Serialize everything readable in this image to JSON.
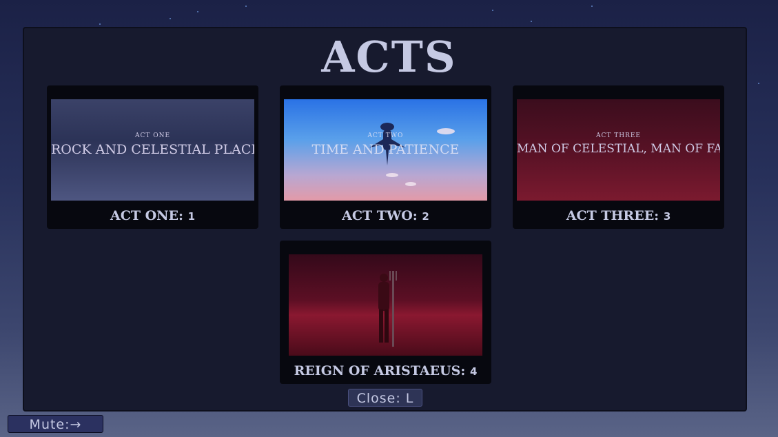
{
  "title": "ACTS",
  "cards": [
    {
      "label": "ACT ONE:",
      "number": "1",
      "thumb_small": "ACT ONE",
      "thumb_title": "ROCK AND CELESTIAL PLACE"
    },
    {
      "label": "ACT TWO:",
      "number": "2",
      "thumb_small": "ACT TWO",
      "thumb_title": "TIME AND PATIENCE"
    },
    {
      "label": "ACT THREE:",
      "number": "3",
      "thumb_small": "ACT THREE",
      "thumb_title": "MAN OF CELESTIAL, MAN OF FAITH"
    },
    {
      "label": "REIGN OF ARISTAEUS:",
      "number": "4"
    }
  ],
  "close_button": "Close: L",
  "mute_button": "Mute:→",
  "colors": {
    "panel": "#171a2e",
    "text": "#c5c9e3",
    "card": "#07080f"
  },
  "icons": [
    "airship-icon",
    "trident-figure-icon"
  ]
}
